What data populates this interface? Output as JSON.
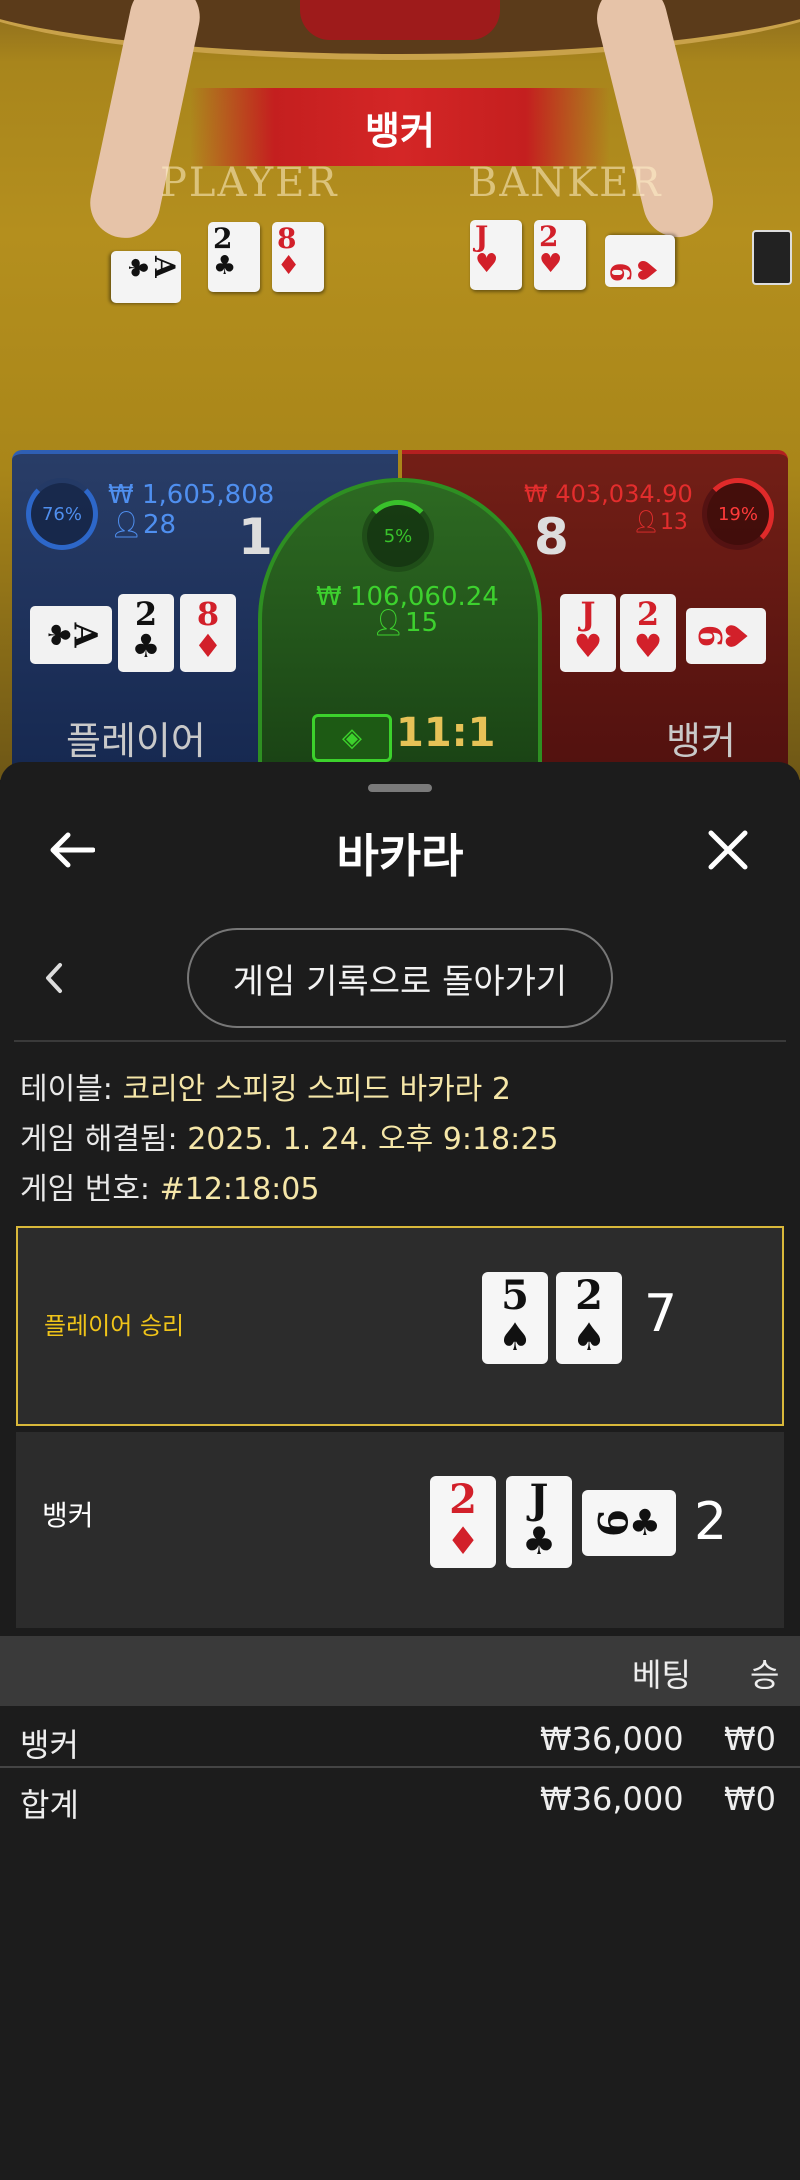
{
  "video": {
    "banner": "뱅커",
    "felt_player": "PLAYER",
    "felt_banker": "BANKER",
    "player_cards": [
      {
        "rank": "A",
        "suit": "♣",
        "color": "black"
      },
      {
        "rank": "2",
        "suit": "♣",
        "color": "black"
      },
      {
        "rank": "8",
        "suit": "♦",
        "color": "red"
      }
    ],
    "banker_cards": [
      {
        "rank": "J",
        "suit": "♥",
        "color": "red"
      },
      {
        "rank": "2",
        "suit": "♥",
        "color": "red"
      },
      {
        "rank": "9",
        "suit": "♥",
        "color": "red"
      }
    ]
  },
  "scoreboard": {
    "player": {
      "percent": "76%",
      "amount": "₩ 1,605,808",
      "bettors": "28",
      "score": "1",
      "label": "플레이어",
      "cards": [
        {
          "rank": "A",
          "suit": "♣",
          "color": "#111111"
        },
        {
          "rank": "2",
          "suit": "♣",
          "color": "#111111"
        },
        {
          "rank": "8",
          "suit": "♦",
          "color": "#d2202a"
        }
      ]
    },
    "tie": {
      "percent": "5%",
      "amount": "₩ 106,060.24",
      "bettors": "15",
      "odds": "11:1"
    },
    "banker": {
      "percent": "19%",
      "amount": "₩ 403,034.90",
      "bettors": "13",
      "score": "8",
      "label": "뱅커",
      "cards": [
        {
          "rank": "J",
          "suit": "♥",
          "color": "#d2202a"
        },
        {
          "rank": "2",
          "suit": "♥",
          "color": "#d2202a"
        },
        {
          "rank": "9",
          "suit": "♥",
          "color": "#d2202a"
        }
      ]
    }
  },
  "sheet": {
    "title": "바카라",
    "back_to_history": "게임 기록으로 돌아가기",
    "table_label": "테이블:",
    "table_value": "코리안 스피킹 스피드 바카라 2",
    "resolved_label": "게임 해결됨:",
    "resolved_value": "2025. 1. 24. 오후 9:18:25",
    "game_no_label": "게임 번호:",
    "game_no_value": "#12:18:05",
    "player_result": {
      "label": "플레이어 승리",
      "score": "7",
      "cards": [
        {
          "rank": "5",
          "suit": "♠",
          "color": "#111111"
        },
        {
          "rank": "2",
          "suit": "♠",
          "color": "#111111"
        }
      ]
    },
    "banker_result": {
      "label": "뱅커",
      "score": "2",
      "cards": [
        {
          "rank": "2",
          "suit": "♦",
          "color": "#d2202a"
        },
        {
          "rank": "J",
          "suit": "♣",
          "color": "#111111"
        },
        {
          "rank": "9",
          "suit": "♣",
          "color": "#111111"
        }
      ]
    },
    "bets": {
      "headers": {
        "bet": "베팅",
        "win": "승"
      },
      "rows": [
        {
          "name": "뱅커",
          "bet": "₩36,000",
          "win": "₩0"
        },
        {
          "name": "합계",
          "bet": "₩36,000",
          "win": "₩0"
        }
      ]
    }
  },
  "colors": {
    "player_blue": "#2d67c9",
    "banker_red": "#d42626",
    "tie_green": "#2e8f22",
    "win_border": "#d9b83a",
    "win_label": "#f0c419"
  }
}
